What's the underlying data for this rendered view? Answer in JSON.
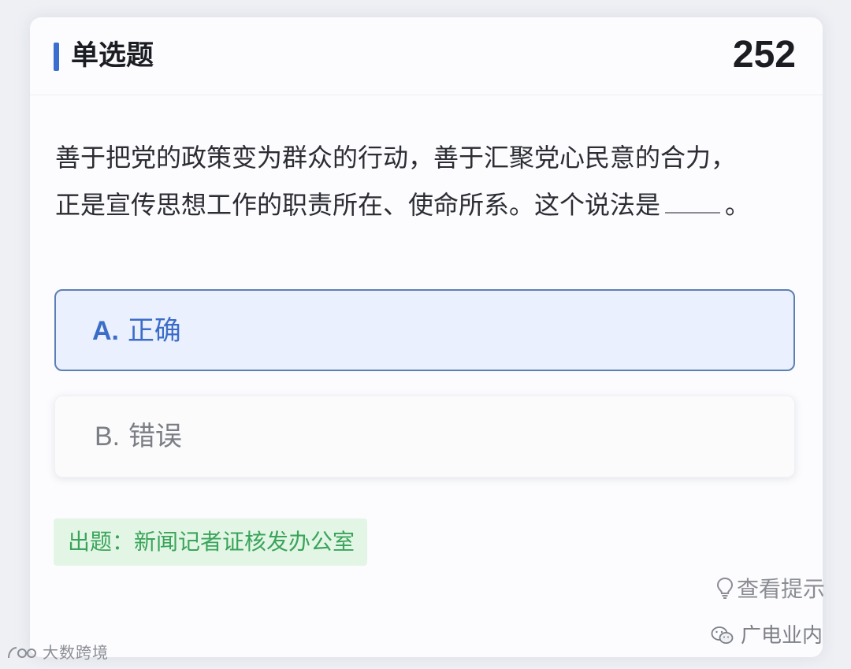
{
  "header": {
    "title": "单选题",
    "number": "252"
  },
  "question": {
    "line1": "善于把党的政策变为群众的行动，善于汇聚党心民意的合力，",
    "line2_before": "正是宣传思想工作的职责所在、使命所系。这个说法是",
    "line2_after": "。"
  },
  "options": [
    {
      "letter": "A.",
      "text": "正确",
      "selected": true
    },
    {
      "letter": "B.",
      "text": "错误",
      "selected": false
    }
  ],
  "source": {
    "text": "出题：新闻记者证核发办公室"
  },
  "hint": {
    "label": "查看提示",
    "icon": "lightbulb-icon"
  },
  "watermarks": {
    "right": "广电业内",
    "right_icon": "wechat-icon",
    "left": "大数跨境",
    "left_icon": "logo-icon"
  },
  "colors": {
    "accent": "#3a6fd0",
    "selected_bg": "#eaf0fd",
    "selected_border": "#5d7fb4",
    "source_bg": "#e3f6e6",
    "source_text": "#3aa45a"
  }
}
